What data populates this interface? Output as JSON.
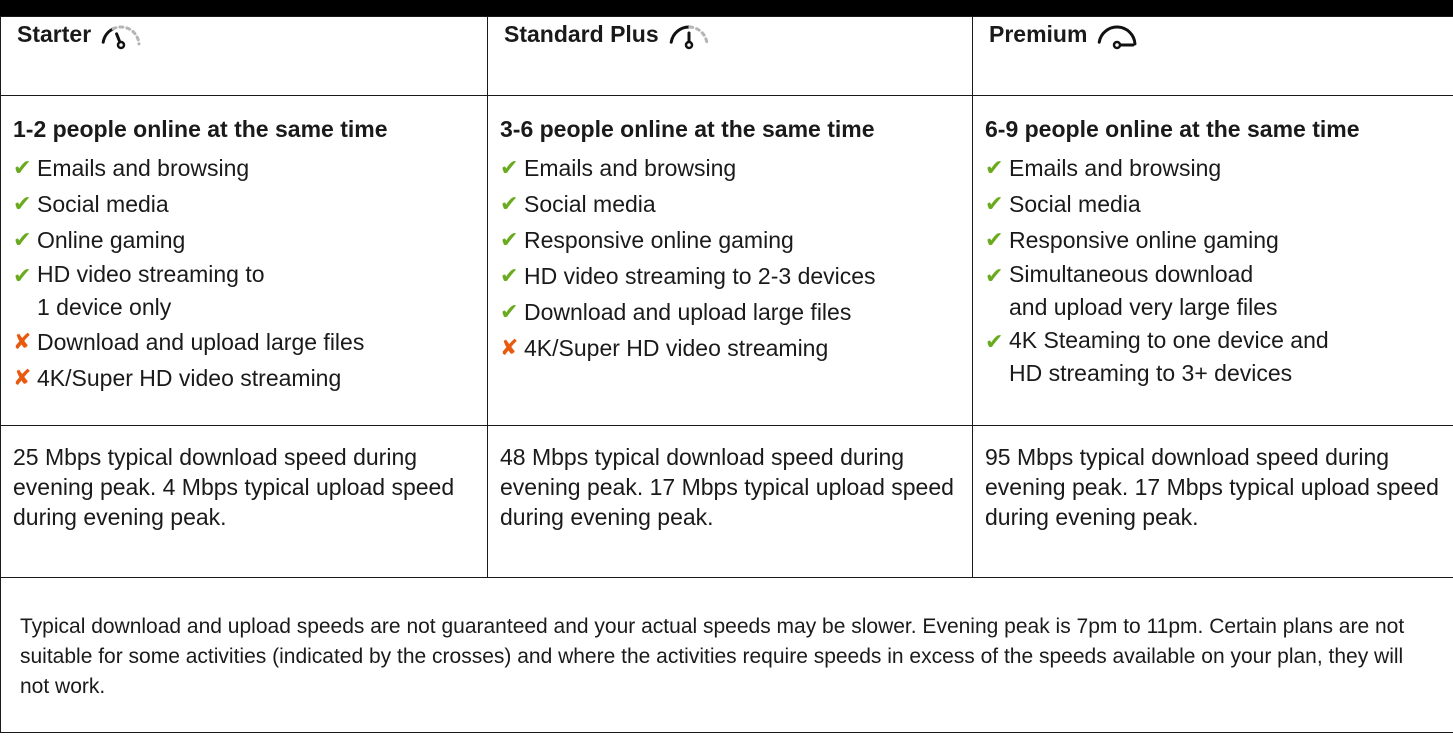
{
  "colors": {
    "check": "#6aaa1e",
    "cross": "#e85a10",
    "gauge_active": "#111111",
    "gauge_inactive": "#b5b5b5"
  },
  "plans": [
    {
      "name": "Starter",
      "gauge_icon": "speed-gauge-low-icon",
      "gauge_level": 0.33,
      "title": "1-2 people online at the same time",
      "features": [
        {
          "status": "check",
          "icon": "✔",
          "text": "Emails and browsing"
        },
        {
          "status": "check",
          "icon": "✔",
          "text": "Social media"
        },
        {
          "status": "check",
          "icon": "✔",
          "text": "Online gaming"
        },
        {
          "status": "check",
          "icon": "✔",
          "text": "HD video streaming to\n1 device only"
        },
        {
          "status": "cross",
          "icon": "✘",
          "text": "Download and upload large files"
        },
        {
          "status": "cross",
          "icon": "✘",
          "text": "4K/Super HD video streaming"
        }
      ],
      "speed": "25 Mbps typical download speed during evening peak. 4 Mbps typical upload speed during evening peak."
    },
    {
      "name": "Standard Plus",
      "gauge_icon": "speed-gauge-medium-icon",
      "gauge_level": 0.5,
      "title": "3-6 people online at the same time",
      "features": [
        {
          "status": "check",
          "icon": "✔",
          "text": "Emails and browsing"
        },
        {
          "status": "check",
          "icon": "✔",
          "text": "Social media"
        },
        {
          "status": "check",
          "icon": "✔",
          "text": "Responsive online gaming"
        },
        {
          "status": "check",
          "icon": "✔",
          "text": "HD video streaming to 2-3 devices"
        },
        {
          "status": "check",
          "icon": "✔",
          "text": "Download and upload large files"
        },
        {
          "status": "cross",
          "icon": "✘",
          "text": "4K/Super HD video streaming"
        }
      ],
      "speed": "48 Mbps typical download speed during evening peak. 17 Mbps typical upload speed during evening peak."
    },
    {
      "name": "Premium",
      "gauge_icon": "speed-gauge-high-icon",
      "gauge_level": 1.0,
      "title": "6-9 people online at the same time",
      "features": [
        {
          "status": "check",
          "icon": "✔",
          "text": "Emails and browsing"
        },
        {
          "status": "check",
          "icon": "✔",
          "text": "Social media"
        },
        {
          "status": "check",
          "icon": "✔",
          "text": "Responsive online gaming"
        },
        {
          "status": "check",
          "icon": "✔",
          "text": "Simultaneous download\nand upload very large files"
        },
        {
          "status": "check",
          "icon": "✔",
          "text": "4K Steaming to one device and\nHD streaming to 3+ devices"
        }
      ],
      "speed": "95 Mbps typical download speed during evening peak. 17 Mbps typical upload speed during evening peak."
    }
  ],
  "footnote": "Typical download and upload speeds are not guaranteed and your actual speeds may be slower. Evening peak is 7pm to 11pm. Certain plans are not suitable for some activities (indicated by the crosses) and where the activities require speeds in excess of the speeds available on your plan, they will not work."
}
